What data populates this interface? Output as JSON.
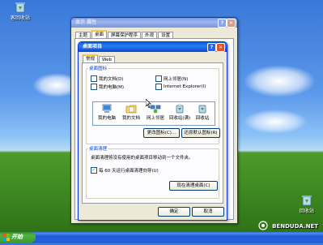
{
  "desktop": {
    "icons": [
      {
        "label": "客回收站",
        "icon": "recycle-bin-icon"
      },
      {
        "label": "回收站",
        "icon": "recycle-bin-icon"
      }
    ]
  },
  "display_window": {
    "title": "显示 属性",
    "tabs": [
      "主题",
      "桌面",
      "屏幕保护程序",
      "外观",
      "设置"
    ]
  },
  "dialog": {
    "title": "桌面项目",
    "tabs": [
      "常规",
      "Web"
    ],
    "group_icons_label": "桌面图标",
    "checkboxes": [
      {
        "label": "我的文档(D)",
        "checked": false
      },
      {
        "label": "网上邻居(N)",
        "checked": false
      },
      {
        "label": "我的电脑(M)",
        "checked": false
      },
      {
        "label": "Internet Explorer(I)",
        "checked": false
      }
    ],
    "icon_list": [
      {
        "label": "我的电脑",
        "icon": "my-computer-icon"
      },
      {
        "label": "我的文档",
        "icon": "my-documents-icon"
      },
      {
        "label": "网上邻居",
        "icon": "network-icon"
      },
      {
        "label": "回收站(满)",
        "icon": "recycle-bin-full-icon"
      },
      {
        "label": "回收站",
        "icon": "recycle-bin-icon"
      }
    ],
    "change_icon_button": "更改图标(C)...",
    "restore_default_button": "还原默认图标(R)",
    "cleanup_group_label": "桌面清理",
    "cleanup_desc": "桌面清理将没有使用的桌面项目移动到一个文件夹。",
    "cleanup_checkbox": "每 60 天运行桌面清理向导(U)",
    "cleanup_checked": true,
    "cleanup_now_button": "现在清理桌面(C)",
    "ok_button": "确定",
    "cancel_button": "取消"
  },
  "taskbar": {
    "start_label": "开始"
  },
  "watermark": "BENDUDA.NET",
  "colors": {
    "titlebar": "#0a5fe0",
    "start_green": "#3c9a32",
    "taskbar_blue": "#2157d7"
  }
}
